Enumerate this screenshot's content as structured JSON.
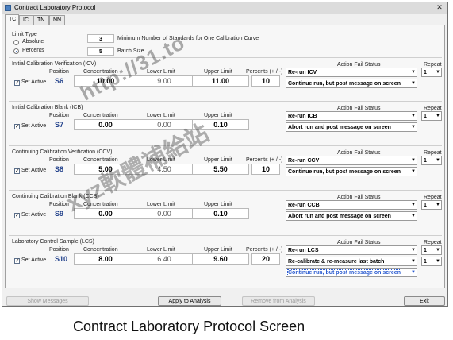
{
  "window": {
    "title": "Contract Laboratory Protocol",
    "close_glyph": "✕"
  },
  "tabs": [
    {
      "label": "TC"
    },
    {
      "label": "IC"
    },
    {
      "label": "TN"
    },
    {
      "label": "NN"
    }
  ],
  "limit_type": {
    "label": "Limit Type",
    "options": [
      {
        "label": "Absolute",
        "selected": false
      },
      {
        "label": "Percents",
        "selected": true
      }
    ],
    "min_standards_value": "3",
    "min_standards_label": "Minimum Number of Standards for One Calibration Curve",
    "batch_size_value": "5",
    "batch_size_label": "Batch Size"
  },
  "headers": {
    "position": "Position",
    "concentration": "Concentration",
    "lower_limit": "Lower Limit",
    "upper_limit": "Upper Limit",
    "percents": "Percents (+ / -)",
    "action_fail_status": "Action Fail Status",
    "repeat": "Repeat"
  },
  "set_active_label": "Set Active",
  "sections": [
    {
      "title": "Initial Calibration Verification (ICV)",
      "set_active": true,
      "position": "S6",
      "concentration": "10.00",
      "lower_limit": "9.00",
      "upper_limit": "11.00",
      "percents": "10",
      "actions": [
        {
          "text": "Re-run ICV",
          "repeat": "1"
        },
        {
          "text": "Continue run, but post message on screen",
          "repeat": null
        }
      ]
    },
    {
      "title": "Initial Calibration Blank (ICB)",
      "set_active": true,
      "position": "S7",
      "concentration": "0.00",
      "lower_limit": "0.00",
      "upper_limit": "0.10",
      "percents": "",
      "actions": [
        {
          "text": "Re-run ICB",
          "repeat": "1"
        },
        {
          "text": "Abort run and post message on screen",
          "repeat": null
        }
      ]
    },
    {
      "title": "Continuing Calibration Verification (CCV)",
      "set_active": true,
      "position": "S8",
      "concentration": "5.00",
      "lower_limit": "4.50",
      "upper_limit": "5.50",
      "percents": "10",
      "actions": [
        {
          "text": "Re-run CCV",
          "repeat": "1"
        },
        {
          "text": "Continue run, but post message on screen",
          "repeat": null
        }
      ]
    },
    {
      "title": "Continuing Calibration Blank (CCB)",
      "set_active": true,
      "position": "S9",
      "concentration": "0.00",
      "lower_limit": "0.00",
      "upper_limit": "0.10",
      "percents": "",
      "actions": [
        {
          "text": "Re-run CCB",
          "repeat": "1"
        },
        {
          "text": "Abort run and post message on screen",
          "repeat": null
        }
      ]
    },
    {
      "title": "Laboratory Control Sample (LCS)",
      "set_active": true,
      "position": "S10",
      "concentration": "8.00",
      "lower_limit": "6.40",
      "upper_limit": "9.60",
      "percents": "20",
      "actions": [
        {
          "text": "Re-run LCS",
          "repeat": "1"
        },
        {
          "text": "Re-calibrate & re-measure last batch",
          "repeat": "1"
        },
        {
          "text": "Continue run, but post message on screen",
          "repeat": null
        }
      ]
    }
  ],
  "buttons": {
    "show_messages": "Show Messages",
    "apply": "Apply to Analysis",
    "remove": "Remove from Analysis",
    "exit": "Exit"
  },
  "caption": "Contract Laboratory Protocol Screen",
  "watermark": {
    "text1": "http://31.to",
    "text2": "xyz軟體補給站"
  }
}
